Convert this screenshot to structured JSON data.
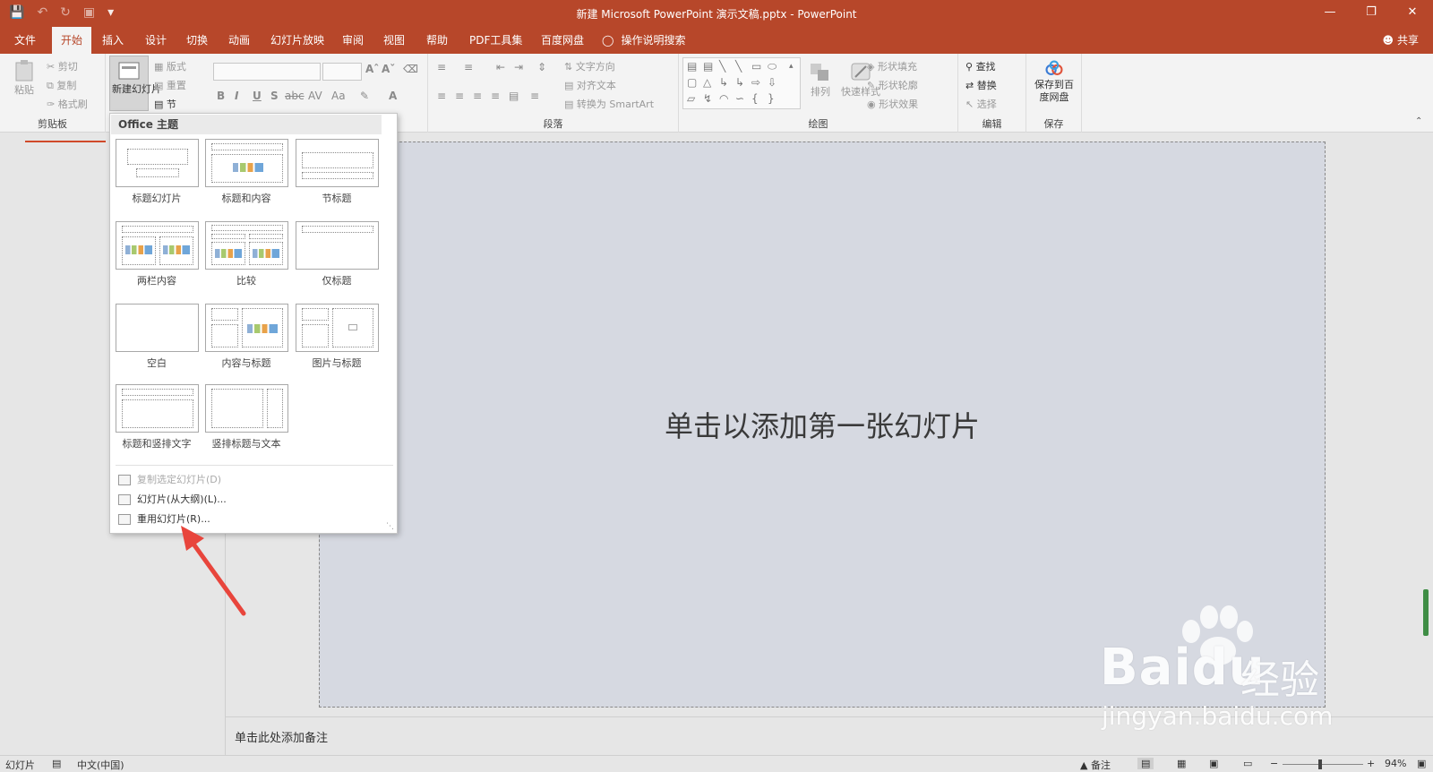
{
  "window": {
    "title": "新建 Microsoft PowerPoint 演示文稿.pptx  -  PowerPoint"
  },
  "qat": {
    "save_icon": "save-icon",
    "undo_icon": "undo-icon",
    "redo_icon": "redo-icon"
  },
  "tabs": [
    "文件",
    "开始",
    "插入",
    "设计",
    "切换",
    "动画",
    "幻灯片放映",
    "审阅",
    "视图",
    "帮助",
    "PDF工具集",
    "百度网盘"
  ],
  "active_tab": "开始",
  "tell_me": "操作说明搜索",
  "share": "共享",
  "ribbon": {
    "clipboard": {
      "paste": "粘贴",
      "cut": "剪切",
      "copy": "复制",
      "format_painter": "格式刷",
      "label": "剪贴板"
    },
    "slides": {
      "new_slide": "新建幻灯片",
      "layout": "版式",
      "reset": "重置",
      "section": "节"
    },
    "paragraph": {
      "text_direction": "文字方向",
      "align_text": "对齐文本",
      "convert_smartart": "转换为 SmartArt",
      "label": "段落"
    },
    "drawing": {
      "arrange": "排列",
      "quick_styles": "快速样式",
      "shape_fill": "形状填充",
      "shape_outline": "形状轮廓",
      "shape_effects": "形状效果",
      "label": "绘图"
    },
    "editing": {
      "find": "查找",
      "replace": "替换",
      "select": "选择",
      "label": "编辑"
    },
    "save": {
      "save_to_baidu": "保存到百度网盘",
      "label": "保存"
    }
  },
  "dropdown": {
    "header": "Office 主题",
    "layouts": [
      "标题幻灯片",
      "标题和内容",
      "节标题",
      "两栏内容",
      "比较",
      "仅标题",
      "空白",
      "内容与标题",
      "图片与标题",
      "标题和竖排文字",
      "竖排标题与文本"
    ],
    "menu": [
      {
        "label": "复制选定幻灯片(D)",
        "enabled": false
      },
      {
        "label": "幻灯片(从大纲)(L)...",
        "enabled": true
      },
      {
        "label": "重用幻灯片(R)...",
        "enabled": true
      }
    ]
  },
  "slide": {
    "placeholder": "单击以添加第一张幻灯片"
  },
  "notes": {
    "placeholder": "单击此处添加备注"
  },
  "status": {
    "slide": "幻灯片",
    "language": "中文(中国)",
    "notes": "备注",
    "zoom": "94%"
  },
  "watermark": {
    "brand": "Bai",
    "brand_du": "du",
    "cn": "经验",
    "url": "jingyan.baidu.com"
  },
  "colors": {
    "accent": "#b7472a",
    "arrow": "#e8453c"
  }
}
